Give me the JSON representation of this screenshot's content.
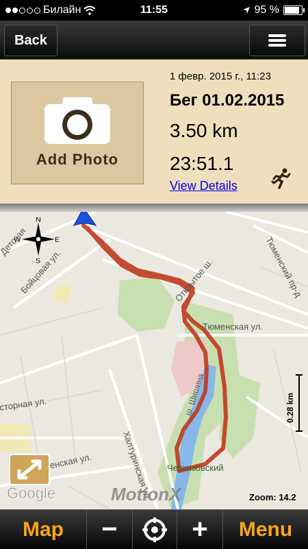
{
  "status_bar": {
    "carrier": "Билайн",
    "time": "11:55",
    "battery": "95 %"
  },
  "nav": {
    "back_label": "Back",
    "menu_icon": "hamburger-icon"
  },
  "activity": {
    "add_photo_label": "Add Photo",
    "datetime": "1 февр. 2015 г., 11:23",
    "title": "Бег 01.02.2015",
    "distance": "3.50 km",
    "duration": "23:51.1",
    "view_details": "View Details",
    "activity_icon": "runner-icon"
  },
  "map": {
    "streets": {
      "tyumensky": "Тюменский пр-д",
      "tyumenskaya": "Тюменская ул.",
      "otkrytoe": "Открытое ш.",
      "boytsovaya": "Бойцовая ул.",
      "detskaya": "Детская",
      "storozhnaya": "сторная ул.",
      "khalturinskaya": "Халтуринская ул.",
      "znamenskaya": "аменская ул.",
      "cherkizovsky": "Черкизовский",
      "shosse": "ш. Шишина"
    },
    "compass": {
      "n": "N",
      "s": "S",
      "e": "E",
      "w": "W"
    },
    "scale_label": "0.28 km",
    "zoom_label": "Zoom: 14.2",
    "google_label": "Google",
    "brand_label": "MotionX",
    "route_color": "#c0391f"
  },
  "toolbar": {
    "map_label": "Map",
    "minus_label": "−",
    "plus_label": "+",
    "menu_label": "Menu",
    "accent_color": "#f7a41a"
  }
}
